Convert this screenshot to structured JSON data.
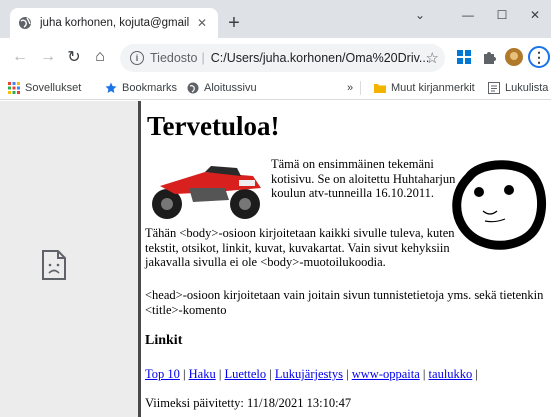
{
  "tab": {
    "title": "juha korhonen, kojuta@gmail.com",
    "close_glyph": "✕",
    "new_tab_glyph": "+"
  },
  "window_controls": {
    "dropdown": "⌄",
    "minimize": "—",
    "maximize": "☐",
    "close": "✕"
  },
  "toolbar": {
    "back_glyph": "←",
    "forward_glyph": "→",
    "reload_glyph": "↻",
    "home_glyph": "⌂",
    "scheme_label": "Tiedosto",
    "url": "C:/Users/juha.korhonen/Oma%20Driv...",
    "star_glyph": "☆",
    "menu_glyph": "⋮"
  },
  "bookmarks_bar": {
    "items": [
      {
        "label": "Sovellukset",
        "icon": "apps-grid-icon"
      },
      {
        "label": "Bookmarks",
        "icon": "star-icon"
      },
      {
        "label": "Aloitussivu",
        "icon": "globe-icon"
      }
    ],
    "overflow_glyph": "»",
    "other_label": "Muut kirjanmerkit",
    "reading_list_label": "Lukulista"
  },
  "page": {
    "heading": "Tervetuloa!",
    "intro": "Tämä on ensimmäinen tekemäni kotisivu. Se on aloitettu Huhtaharjun koulun atv-tunneilla 16.10.2011.",
    "paragraph1": "Tähän <body>-osioon kirjoitetaan kaikki sivulle tuleva, kuten tekstit, otsikot, linkit, kuvat, kuvakartat. Vain sivut kehyksiin jakavalla sivulla ei ole <body>-muotoilukoodia.",
    "paragraph2": "<head>-osioon kirjoitetaan vain joitain sivun tunnistetietoja yms. sekä tietenkin <title>-komento",
    "links_heading": "Linkit",
    "links": [
      "Top 10",
      "Haku",
      "Luettelo",
      "Lukujärjestys",
      "www-oppaita",
      "taulukko"
    ],
    "link_separator": "|",
    "updated": "Viimeksi päivitetty: 11/18/2021 13:10:47"
  },
  "colors": {
    "tabstrip": "#dee1e6",
    "link": "#0000ee",
    "left_frame": "#ececec",
    "frame_border": "#4a4a4a",
    "accent": "#1a73e8"
  }
}
